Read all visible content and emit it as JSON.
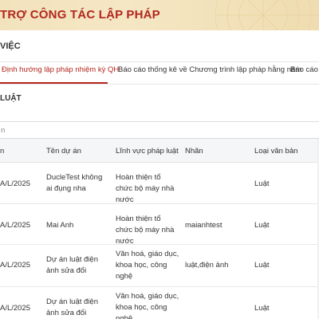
{
  "banner": {
    "title": "TRỢ CÔNG TÁC LẬP PHÁP"
  },
  "section": {
    "title": "VIỆC"
  },
  "tabs": [
    {
      "label": "Định hướng lập pháp nhiệm kỳ QH",
      "active": true
    },
    {
      "label": "Báo cáo thống kê về Chương trình lập pháp hằng năm",
      "active": false
    },
    {
      "label": "Báo cáo t",
      "active": false
    }
  ],
  "sub_label": "LUẬT",
  "search": {
    "placeholder": "n"
  },
  "table": {
    "headers": [
      "n",
      "Tên dự án",
      "Lĩnh vực pháp luật",
      "Nhãn",
      "Loại văn bản"
    ],
    "rows": [
      {
        "code": "A/L/2025",
        "name": "DucleTest không ai đụng nha",
        "field": "Hoàn thiện tổ chức bộ máy nhà nước",
        "tag": "",
        "type": "Luật"
      },
      {
        "code": "A/L/2025",
        "name": "Mai Anh",
        "field": "Hoàn thiện tổ chức bộ máy nhà nước",
        "tag": "maianhtest",
        "type": "Luật"
      },
      {
        "code": "A/L/2025",
        "name": "Dự án luật điện ảnh sửa đổi",
        "field": "Văn hoá, giáo dục, khoa học, công nghệ",
        "tag": "luật,điện ảnh",
        "type": "Luật"
      },
      {
        "code": "A/L/2025",
        "name": "Dự án luật điện ảnh sửa đổi",
        "field": "Văn hoá, giáo dục, khoa học, công nghệ",
        "tag": "",
        "type": "Luật"
      }
    ]
  },
  "colors": {
    "accent": "#b3261e",
    "banner": "#f2e3bd"
  }
}
